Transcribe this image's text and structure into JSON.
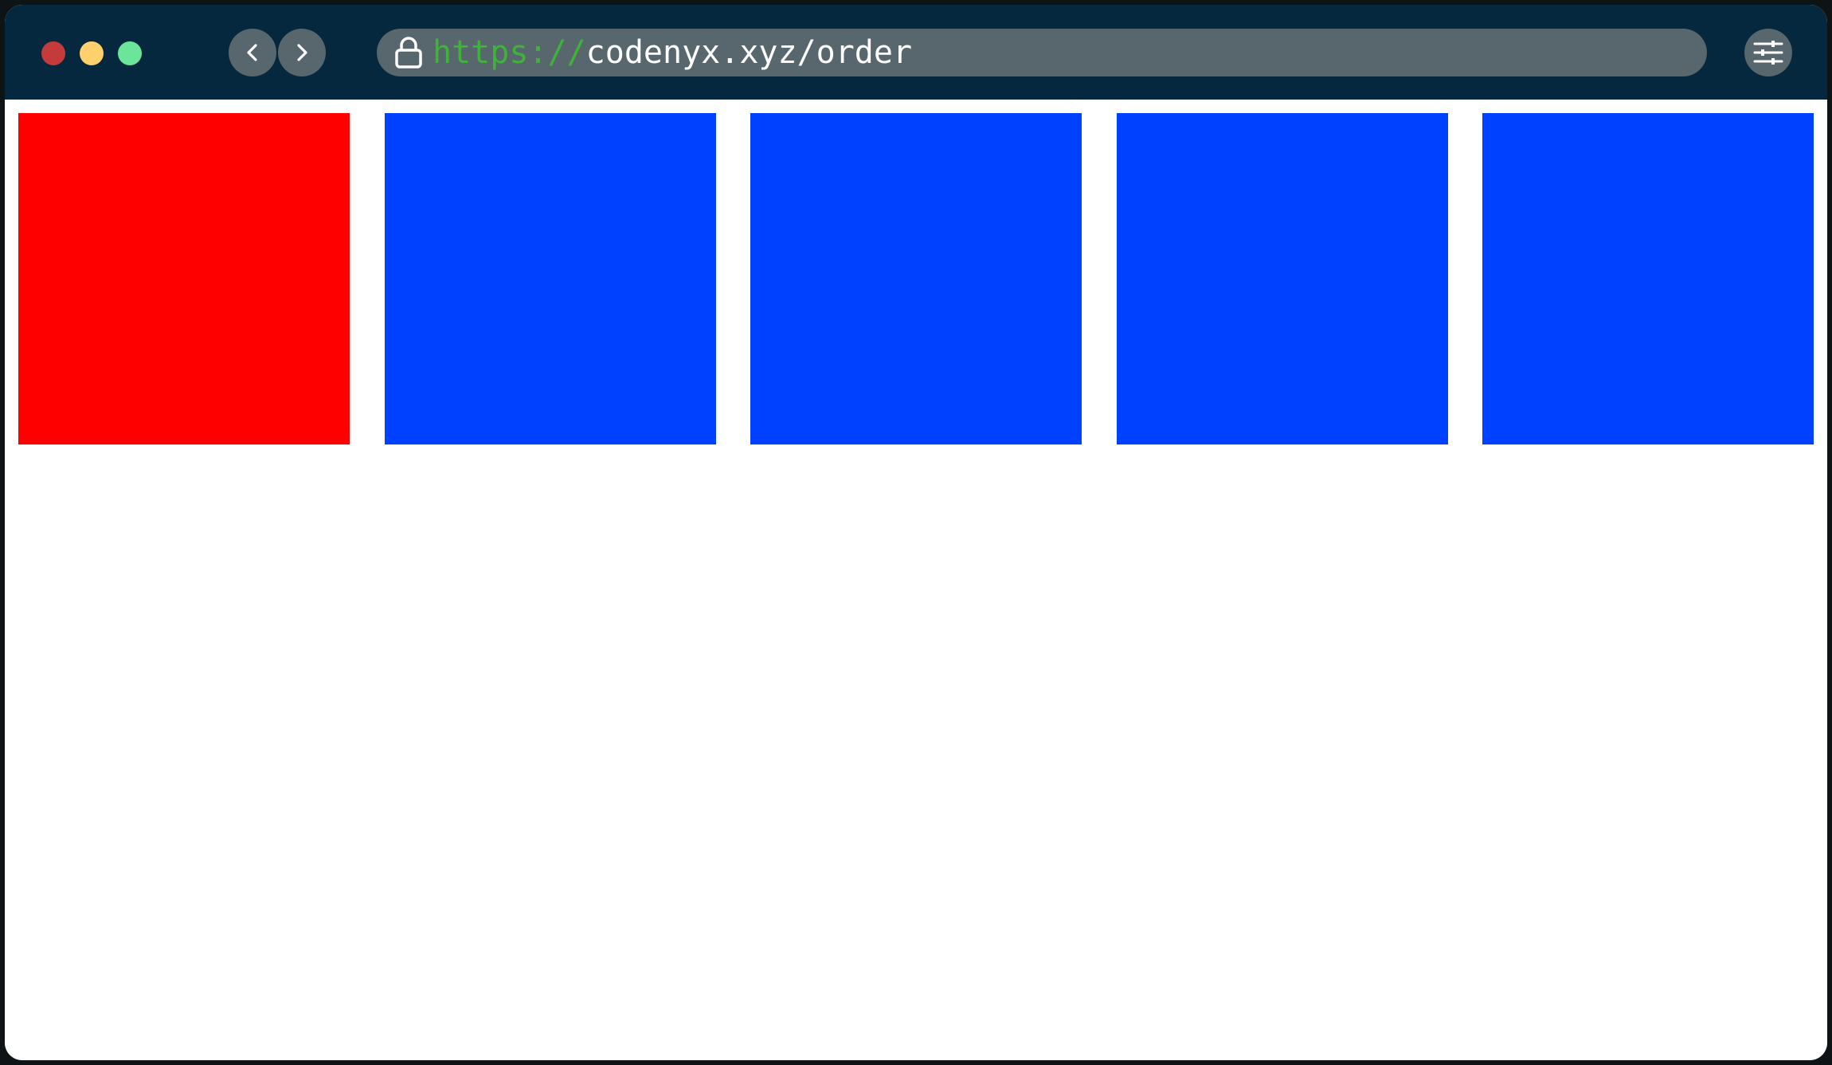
{
  "window": {
    "traffic_lights": [
      {
        "name": "close",
        "color": "#c53a3a"
      },
      {
        "name": "minimize",
        "color": "#ffd06b"
      },
      {
        "name": "maximize",
        "color": "#6be59a"
      }
    ]
  },
  "toolbar": {
    "back_icon": "chevron-left-icon",
    "forward_icon": "chevron-right-icon",
    "settings_icon": "sliders-icon"
  },
  "address_bar": {
    "lock_icon": "lock-icon",
    "scheme": "https://",
    "host_path": "codenyx.xyz/order",
    "scheme_color": "#3fb23a"
  },
  "page": {
    "boxes": [
      {
        "color": "#ff0000"
      },
      {
        "color": "#0040ff"
      },
      {
        "color": "#0040ff"
      },
      {
        "color": "#0040ff"
      },
      {
        "color": "#0040ff"
      }
    ]
  }
}
